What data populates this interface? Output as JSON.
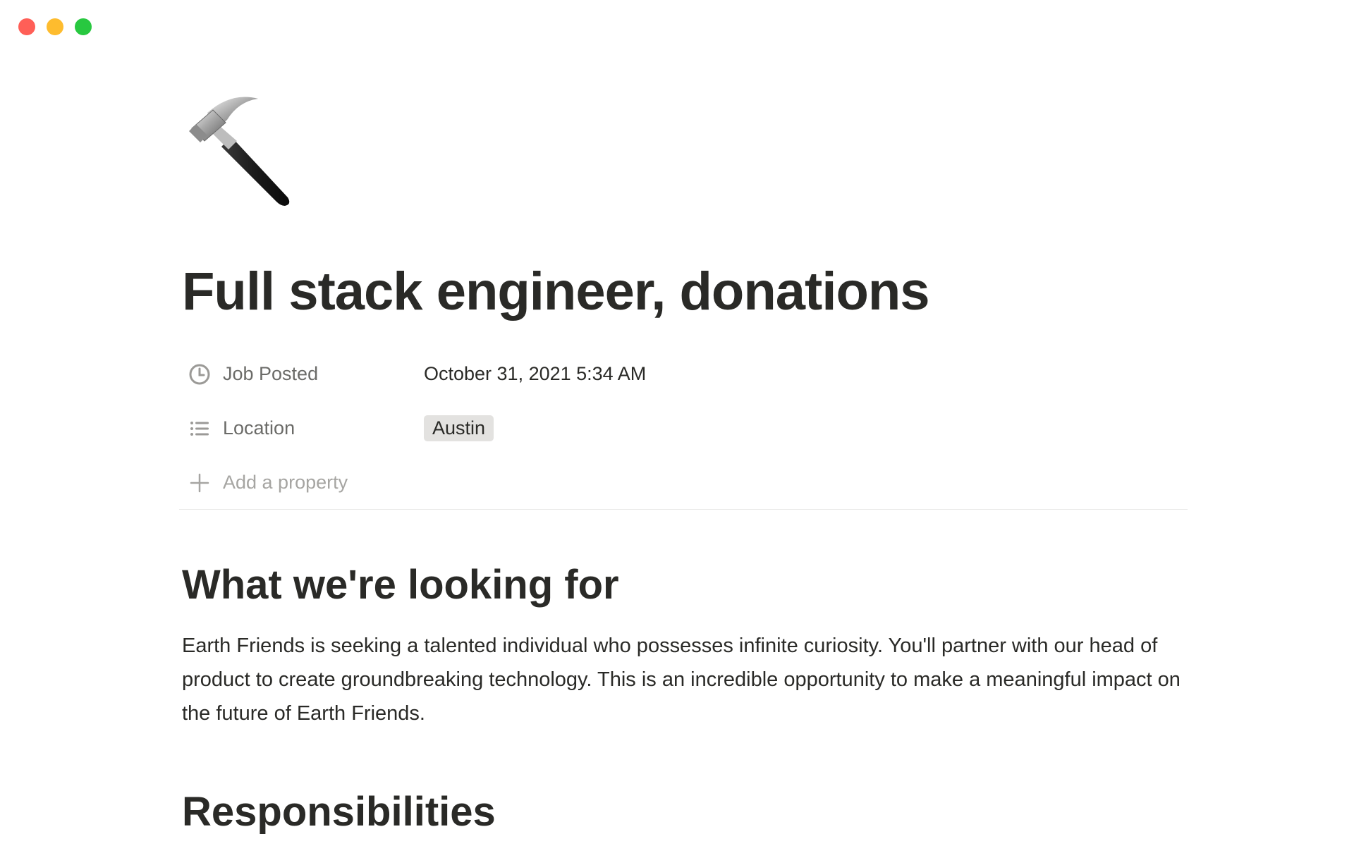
{
  "window": {
    "traffic_lights": {
      "close_color": "#ff5f57",
      "minimize_color": "#febc2e",
      "maximize_color": "#28c840"
    }
  },
  "page": {
    "icon": "hammer-icon",
    "title": "Full stack engineer, donations",
    "properties": [
      {
        "icon": "clock-icon",
        "name": "Job Posted",
        "value": "October 31, 2021 5:34 AM"
      },
      {
        "icon": "list-icon",
        "name": "Location",
        "value": "Austin"
      }
    ],
    "add_property_label": "Add a property",
    "sections": [
      {
        "heading": "What we're looking for",
        "body": "Earth Friends is seeking a talented individual who possesses infinite curiosity. You'll partner with our head of product to create groundbreaking technology. This is an incredible opportunity to make a meaningful impact on the future of Earth Friends."
      },
      {
        "heading": "Responsibilities"
      }
    ]
  }
}
